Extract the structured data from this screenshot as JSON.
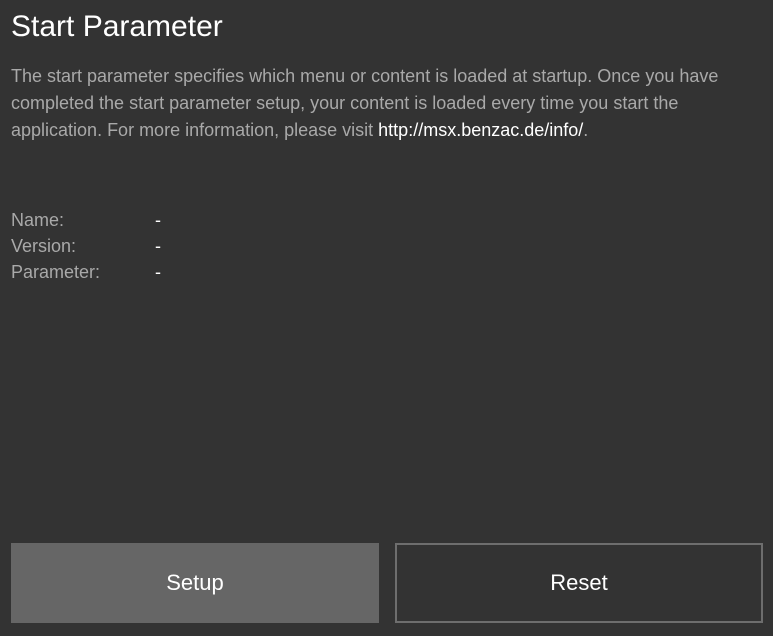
{
  "page": {
    "title": "Start Parameter",
    "description_text": "The start parameter specifies which menu or content is loaded at startup. Once you have completed the start parameter setup, your content is loaded every time you start the application. For more information, please visit ",
    "description_link": "http://msx.benzac.de/info/",
    "description_end": "."
  },
  "info": {
    "name_label": "Name:",
    "name_value": "-",
    "version_label": "Version:",
    "version_value": "-",
    "parameter_label": "Parameter:",
    "parameter_value": "-"
  },
  "buttons": {
    "setup_label": "Setup",
    "reset_label": "Reset"
  },
  "colors": {
    "background": "#333333",
    "text_primary": "#ffffff",
    "text_secondary": "#a9a9a9",
    "button_active": "#666666"
  }
}
